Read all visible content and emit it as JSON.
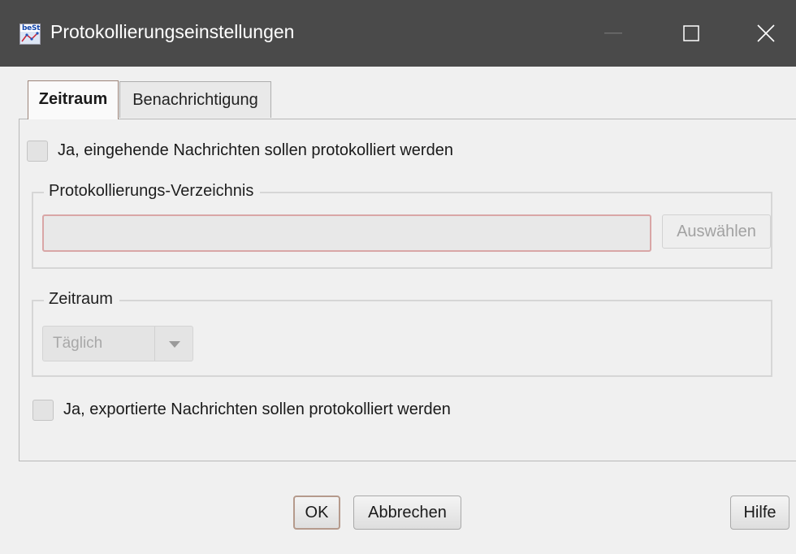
{
  "window": {
    "title": "Protokollierungseinstellungen",
    "app_icon_text": "beSt",
    "icon": "app-icon"
  },
  "tabs": [
    {
      "label": "Zeitraum",
      "active": true
    },
    {
      "label": "Benachrichtigung",
      "active": false
    }
  ],
  "incoming_checkbox": {
    "label": "Ja, eingehende Nachrichten sollen protokolliert werden",
    "checked": false
  },
  "directory_group": {
    "title": "Protokollierungs-Verzeichnis",
    "path_value": "",
    "select_button": "Auswählen"
  },
  "period_group": {
    "title": "Zeitraum",
    "selected": "Täglich"
  },
  "exported_checkbox": {
    "label": "Ja, exportierte Nachrichten sollen protokolliert werden",
    "checked": false
  },
  "buttons": {
    "ok": "OK",
    "cancel": "Abbrechen",
    "help": "Hilfe"
  },
  "colors": {
    "titlebar": "#4a4a4a",
    "window_bg": "#f0f0f0",
    "error_border": "#d9a6a6"
  }
}
